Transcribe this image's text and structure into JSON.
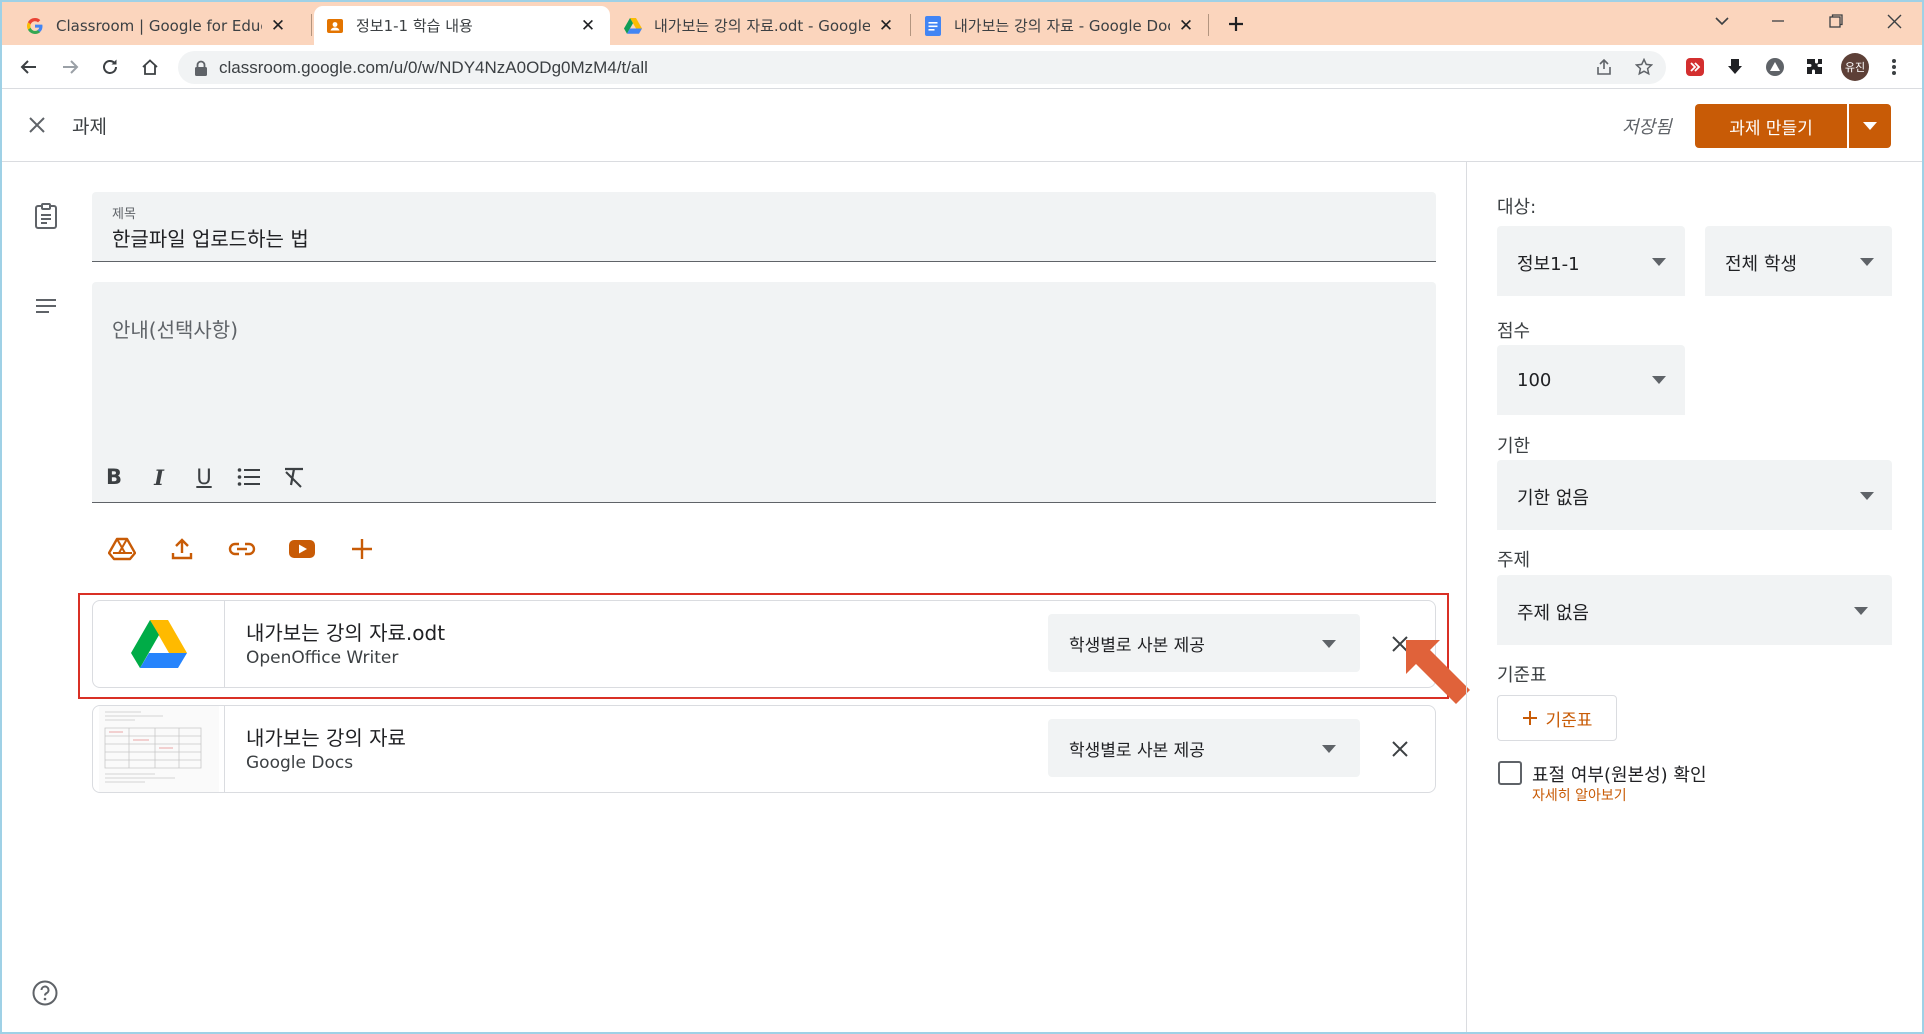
{
  "browser": {
    "tabs": [
      {
        "title": "Classroom | Google for Education",
        "favicon": "google-g-icon",
        "active": false
      },
      {
        "title": "정보1-1 학습 내용",
        "favicon": "classroom-icon",
        "active": true
      },
      {
        "title": "내가보는 강의 자료.odt - Google Drive",
        "favicon": "drive-icon",
        "active": false
      },
      {
        "title": "내가보는 강의 자료 - Google Docs",
        "favicon": "docs-icon",
        "active": false
      }
    ],
    "url": "classroom.google.com/u/0/w/NDY4NzA0ODg0MzM4/t/all",
    "profile_initials": "유진"
  },
  "header": {
    "title": "과제",
    "saved_status": "저장됨",
    "assign_label": "과제 만들기"
  },
  "form": {
    "title_label": "제목",
    "title_value": "한글파일 업로드하는 법",
    "description_placeholder": "안내(선택사항)"
  },
  "attachments": [
    {
      "title": "내가보는 강의 자료.odt",
      "type": "OpenOffice Writer",
      "share_mode": "학생별로 사본 제공",
      "thumbnail": "google-drive-logo-icon"
    },
    {
      "title": "내가보는 강의 자료",
      "type": "Google Docs",
      "share_mode": "학생별로 사본 제공",
      "thumbnail": "document-preview"
    }
  ],
  "panel": {
    "for_label": "대상:",
    "class_value": "정보1-1",
    "students_value": "전체 학생",
    "points_label": "점수",
    "points_value": "100",
    "due_label": "기한",
    "due_value": "기한 없음",
    "topic_label": "주제",
    "topic_value": "주제 없음",
    "rubric_label": "기준표",
    "rubric_button": "기준표",
    "originality_label": "표절 여부(원본성) 확인",
    "learn_more": "자세히 알아보기"
  },
  "colors": {
    "accent": "#c85b06",
    "tab_bar": "#fbd5bd",
    "highlight_box": "#d93025",
    "annotation_arrow": "#e0623a"
  }
}
